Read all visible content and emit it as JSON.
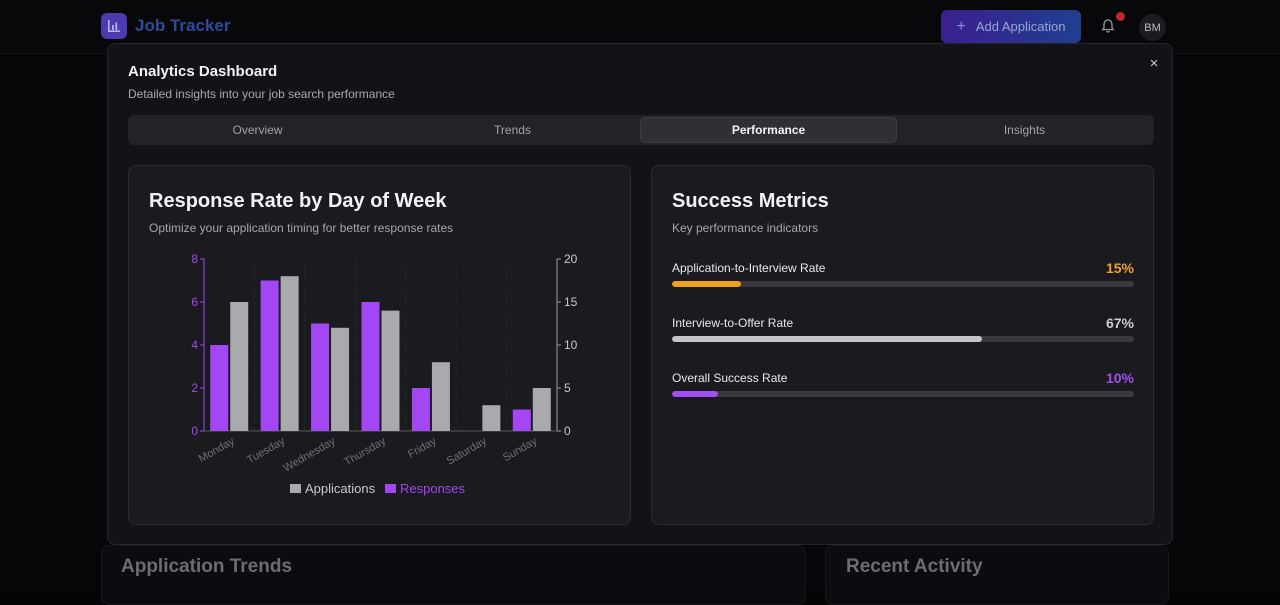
{
  "app": {
    "name": "Job Tracker",
    "add_button_label": "Add Application",
    "avatar_initials": "BM"
  },
  "background": {
    "left_panel_title": "Application Trends",
    "right_panel_title": "Recent Activity"
  },
  "modal": {
    "title": "Analytics Dashboard",
    "subtitle": "Detailed insights into your job search performance",
    "close_glyph": "×",
    "tabs": [
      {
        "label": "Overview",
        "active": false
      },
      {
        "label": "Trends",
        "active": false
      },
      {
        "label": "Performance",
        "active": true
      },
      {
        "label": "Insights",
        "active": false
      }
    ]
  },
  "response_card": {
    "title": "Response Rate by Day of Week",
    "subtitle": "Optimize your application timing for better response rates"
  },
  "metrics_card": {
    "title": "Success Metrics",
    "subtitle": "Key performance indicators",
    "metrics": [
      {
        "label": "Application-to-Interview Rate",
        "value": "15%",
        "fraction": 0.15,
        "color": "#f0a21a",
        "fill": "#f0a21a"
      },
      {
        "label": "Interview-to-Offer Rate",
        "value": "67%",
        "fraction": 0.67,
        "color": "#c9c9cf",
        "fill": "#c4c4ca"
      },
      {
        "label": "Overall Success Rate",
        "value": "10%",
        "fraction": 0.1,
        "color": "#a24ef0",
        "fill": "#a24ef0"
      }
    ]
  },
  "chart_data": {
    "type": "bar",
    "categories": [
      "Monday",
      "Tuesday",
      "Wednesday",
      "Thursday",
      "Friday",
      "Saturday",
      "Sunday"
    ],
    "series": [
      {
        "name": "Responses",
        "axis": "left",
        "color": "#a347f5",
        "values": [
          4,
          7,
          5,
          6,
          2,
          0,
          1
        ]
      },
      {
        "name": "Applications",
        "axis": "right",
        "color": "#a9a9ae",
        "values": [
          15,
          18,
          12,
          14,
          8,
          3,
          5
        ]
      }
    ],
    "left_axis": {
      "ylim": [
        0,
        8
      ],
      "ticks": [
        "0",
        "2",
        "4",
        "6",
        "8"
      ],
      "color": "#a347f5"
    },
    "right_axis": {
      "ylim": [
        0,
        20
      ],
      "ticks": [
        "0",
        "5",
        "10",
        "15",
        "20"
      ],
      "color": "#c9c9cf"
    },
    "legend": [
      "Applications",
      "Responses"
    ],
    "legend_position": "bottom",
    "grid": true
  }
}
